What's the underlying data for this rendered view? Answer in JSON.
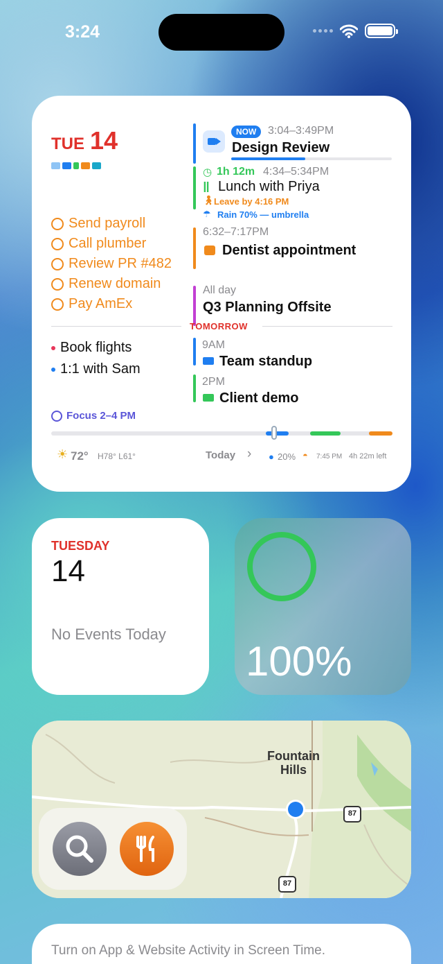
{
  "status_bar": {
    "time": "3:24"
  },
  "calendar_widget": {
    "day_of_week": "TUE",
    "day_number": "14",
    "reminders": [
      "Send payroll",
      "Call plumber",
      "Review PR #482",
      "Renew domain",
      "Pay AmEx"
    ],
    "now_badge": "NOW",
    "current_event": {
      "time": "3:04–3:49PM",
      "title": "Design Review",
      "progress": 0.46
    },
    "countdown": "1h 12m",
    "lunch": {
      "time": "4:34–5:34PM",
      "title": "Lunch with Priya",
      "leave_by": "Leave by 4:16 PM",
      "weather_note": "Rain 70% — umbrella"
    },
    "dentist": {
      "time": "6:32–7:17PM",
      "title": "Dentist appointment"
    },
    "all_day": {
      "label": "All day",
      "title": "Q3 Planning Offsite"
    },
    "tomorrow_label": "TOMORROW",
    "tomorrow_items": [
      "Book flights",
      "1:1 with Sam"
    ],
    "tomorrow_events": [
      {
        "time": "9AM",
        "title": "Team standup"
      },
      {
        "time": "2PM",
        "title": "Client demo"
      }
    ],
    "focus": "Focus 2–4 PM",
    "weather": {
      "temp": "72°",
      "hilo": "H78° L61°"
    },
    "today_label": "Today",
    "rain": "20%",
    "sunset": "7:45 PM",
    "left": "4h 22m left",
    "colors": {
      "red": "#e0312b",
      "blue": "#1f7ef0",
      "green": "#34c759",
      "orange": "#f08a1c",
      "purple": "#c23fd3"
    }
  },
  "day_widget": {
    "day_name": "TUESDAY",
    "day_number": "14",
    "message": "No Events Today"
  },
  "battery_widget": {
    "percent": "100%",
    "level": 1.0
  },
  "map_widget": {
    "place": "Fountain Hills",
    "route_1": "87",
    "route_2": "87",
    "icons": [
      "search-icon",
      "fork-knife-icon"
    ]
  },
  "screen_time_widget": {
    "message": "Turn on App & Website Activity in Screen Time."
  }
}
